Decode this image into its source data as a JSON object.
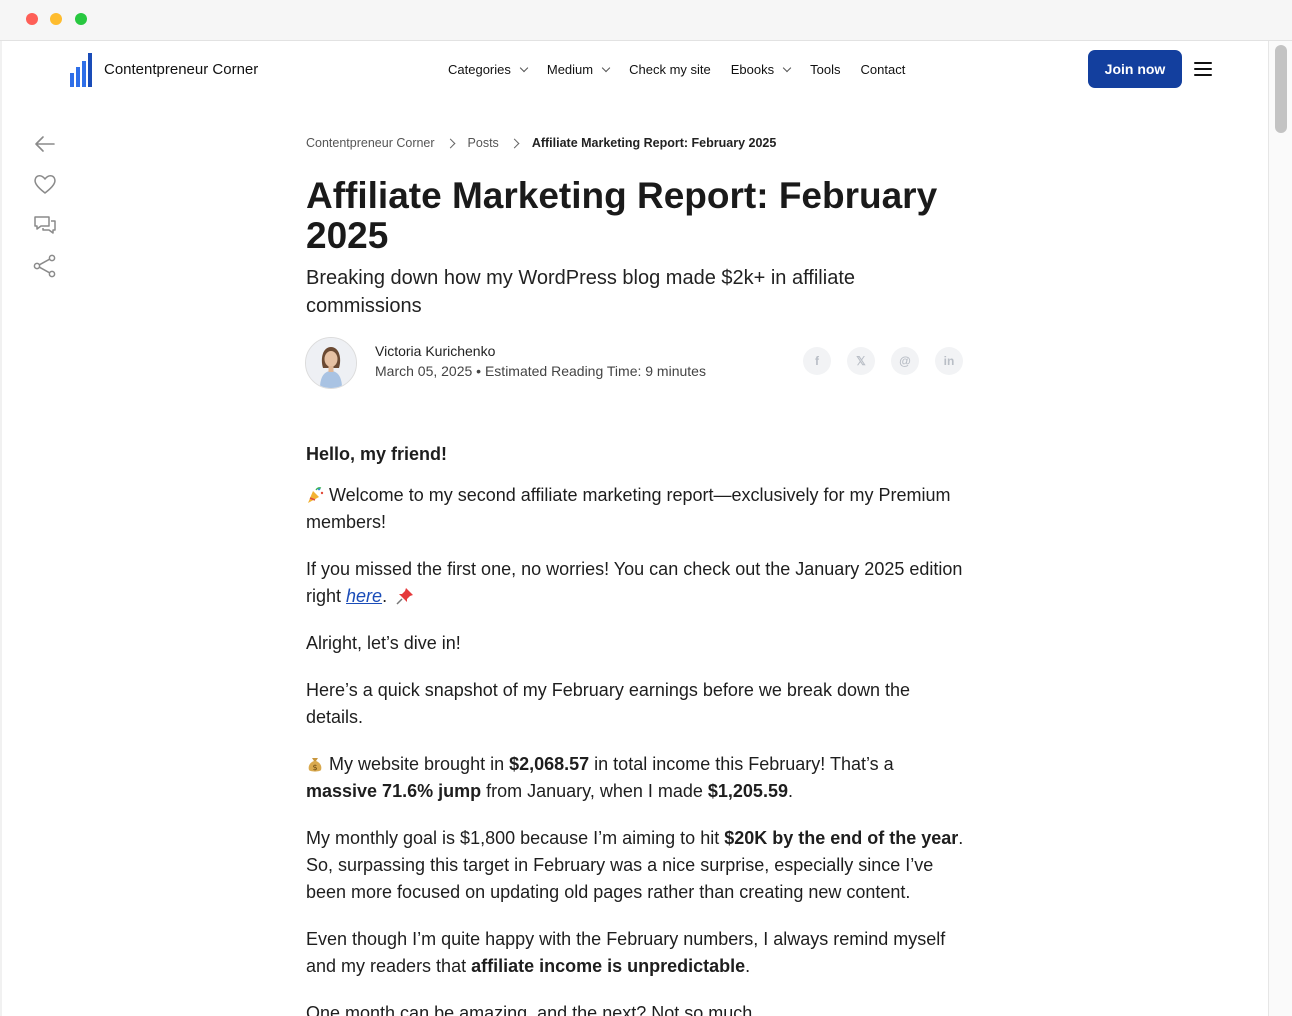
{
  "header": {
    "site_name": "Contentpreneur Corner",
    "nav": [
      "Categories",
      "Medium",
      "Check my site",
      "Ebooks",
      "Tools",
      "Contact"
    ],
    "join_label": "Join now"
  },
  "breadcrumb": {
    "home": "Contentpreneur Corner",
    "section": "Posts",
    "current": "Affiliate Marketing Report: February 2025"
  },
  "article": {
    "title": "Affiliate Marketing Report: February 2025",
    "subtitle": "Breaking down how my WordPress blog made $2k+ in affiliate commissions",
    "author": "Victoria Kurichenko",
    "meta": "March 05, 2025 • Estimated Reading Time: 9 minutes",
    "share": [
      "f",
      "𝕏",
      "@",
      "in"
    ],
    "greeting": "Hello, my friend!",
    "p1": "Welcome to my second affiliate marketing report—exclusively for my Premium members!",
    "p2_a": "If you missed the first one, no worries! You can check out the January 2025 edition right ",
    "p2_link": "here",
    "p2_b": ".",
    "p3": "Alright, let’s dive in!",
    "p4": "Here’s a quick snapshot of my February earnings before we break down the details.",
    "p5_a": "My website brought in ",
    "p5_b": "$2,068.57",
    "p5_c": " in total income this February! That’s a ",
    "p5_d": "massive 71.6% jump",
    "p5_e": " from January, when I made ",
    "p5_f": "$1,205.59",
    "p5_g": ".",
    "p6_a": "My monthly goal is $1,800 because I’m aiming to hit ",
    "p6_b": "$20K by the end of the year",
    "p6_c": ". So, surpassing this target in February was a nice surprise, especially since I’ve been more focused on updating old pages rather than creating new content.",
    "p7_a": "Even though I’m quite happy with the February numbers, I always remind myself and my readers that ",
    "p7_b": "affiliate income is unpredictable",
    "p7_c": ".",
    "p8": "One month can be amazing, and the next? Not so much."
  },
  "icons": {
    "side": [
      "back-arrow-icon",
      "heart-icon",
      "comments-icon",
      "share-icon"
    ],
    "emoji": [
      "party-popper-icon",
      "pushpin-icon",
      "money-bag-icon"
    ]
  },
  "colors": {
    "accent": "#133f9e",
    "link": "#1a4cb8",
    "logo_blue": "#2f6fe8"
  }
}
